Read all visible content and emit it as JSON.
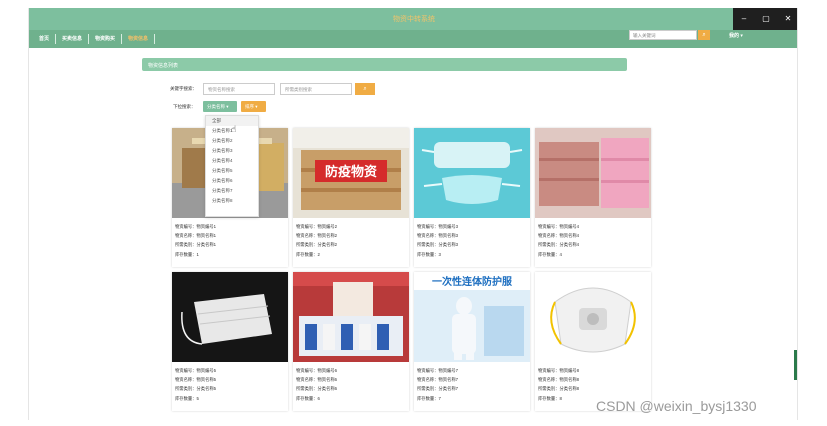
{
  "window": {
    "title": "物资中转系统",
    "controls": [
      "–",
      "▢",
      "✕"
    ]
  },
  "nav": {
    "items": [
      {
        "label": "首页",
        "active": false
      },
      {
        "label": "买卖信息",
        "active": false
      },
      {
        "label": "物资购买",
        "active": false
      },
      {
        "label": "物资信息",
        "active": true
      }
    ],
    "search_placeholder": "输入关键词",
    "search_icon": "search-icon",
    "user_label": "我的 ▾"
  },
  "section": {
    "title": "物资信息列表"
  },
  "filters": {
    "keyword_label": "关键字搜索：",
    "name_placeholder": "物资名称搜索",
    "type_placeholder": "所需类别搜索",
    "dropdown_label": "下拉搜索：",
    "category_button": "分类名称 ▾",
    "sort_button": "排序 ▾",
    "menu_items": [
      "全部",
      "分类名称1",
      "分类名称2",
      "分类名称3",
      "分类名称4",
      "分类名称5",
      "分类名称6",
      "分类名称7",
      "分类名称8"
    ]
  },
  "products": [
    {
      "code": "物资编号：物资编号1",
      "name": "物资名称：物资名称1",
      "type": "所需类别：分类名称1",
      "stock": "库存数量：1"
    },
    {
      "code": "物资编号：物资编号2",
      "name": "物资名称：物资名称2",
      "type": "所需类别：分类名称2",
      "stock": "库存数量：2",
      "banner": "防疫物资"
    },
    {
      "code": "物资编号：物资编号3",
      "name": "物资名称：物资名称3",
      "type": "所需类别：分类名称3",
      "stock": "库存数量：3"
    },
    {
      "code": "物资编号：物资编号4",
      "name": "物资名称：物资名称4",
      "type": "所需类别：分类名称4",
      "stock": "库存数量：4"
    },
    {
      "code": "物资编号：物资编号5",
      "name": "物资名称：物资名称5",
      "type": "所需类别：分类名称5",
      "stock": "库存数量：5"
    },
    {
      "code": "物资编号：物资编号6",
      "name": "物资名称：物资名称6",
      "type": "所需类别：分类名称6",
      "stock": "库存数量：6"
    },
    {
      "code": "物资编号：物资编号7",
      "name": "物资名称：物资名称7",
      "type": "所需类别：分类名称7",
      "stock": "库存数量：7",
      "banner": "一次性连体防护服"
    },
    {
      "code": "物资编号：物资编号8",
      "name": "物资名称：物资名称8",
      "type": "所需类别：分类名称8",
      "stock": "库存数量：8"
    }
  ],
  "watermark": "CSDN @weixin_bysj1330",
  "colors": {
    "nav_green": "#6fb18d",
    "accent_orange": "#f0ac44",
    "title_gold": "#f0c36a"
  }
}
